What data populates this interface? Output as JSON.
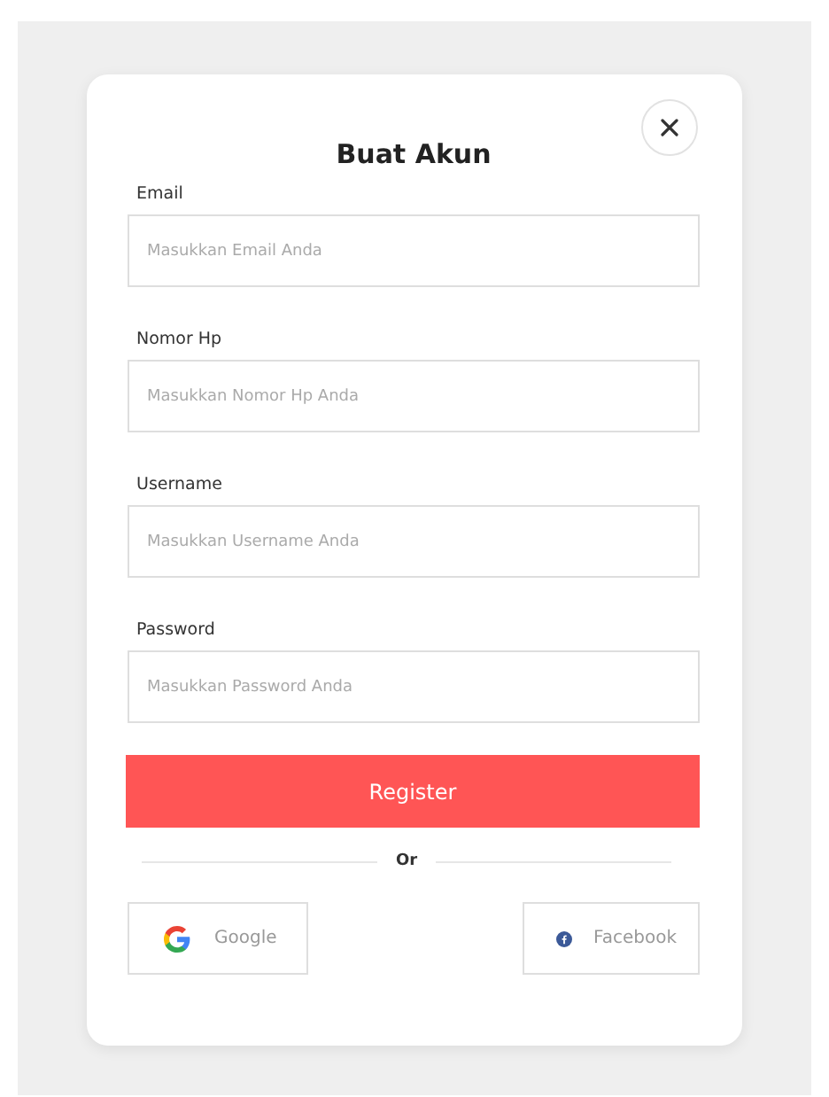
{
  "dialog": {
    "title": "Buat Akun"
  },
  "fields": [
    {
      "label": "Email",
      "placeholder": "Masukkan Email Anda"
    },
    {
      "label": "Nomor Hp",
      "placeholder": "Masukkan Nomor Hp Anda"
    },
    {
      "label": "Username",
      "placeholder": "Masukkan Username Anda"
    },
    {
      "label": "Password",
      "placeholder": "Masukkan Password Anda"
    }
  ],
  "submit": "Register",
  "divider": "Or",
  "social": [
    {
      "kind": "google",
      "label": "Google"
    },
    {
      "kind": "facebook",
      "label": "Facebook"
    }
  ]
}
